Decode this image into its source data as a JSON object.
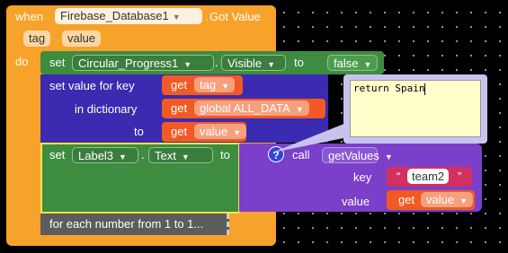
{
  "event": {
    "when": "when",
    "component": "Firebase_Database1",
    "dot": ".",
    "event_name": "Got Value",
    "params": [
      "tag",
      "value"
    ],
    "do": "do"
  },
  "set_visible": {
    "set": "set",
    "component": "Circular_Progress1",
    "dot": ".",
    "property": "Visible",
    "to": "to",
    "value": "false"
  },
  "dict_block": {
    "label_set_value": "set value for key",
    "label_in_dict": "in dictionary",
    "label_to": "to",
    "get1": {
      "get": "get",
      "var": "tag"
    },
    "get2": {
      "get": "get",
      "var": "global ALL_DATA"
    },
    "get3": {
      "get": "get",
      "var": "value"
    }
  },
  "set_text": {
    "set": "set",
    "component": "Label3",
    "dot": ".",
    "property": "Text",
    "to": "to"
  },
  "call_block": {
    "question": "?",
    "call": "call",
    "proc": "getValues",
    "key_label": "key",
    "value_label": "value",
    "key_string": "team2",
    "quote_open": "“",
    "quote_close": "”",
    "get_word": "get",
    "value_var": "value"
  },
  "comment": {
    "text": "return Spain"
  },
  "collapsed": {
    "text": "for each number from 1 to 1..."
  },
  "colors": {
    "event": "#f7a22a",
    "component_green": "#3d8c40",
    "dict_blue": "#3a2bb0",
    "variable_orange": "#f15a24",
    "procedure_purple": "#7b3fc9",
    "text_pink": "#d4305f",
    "collapsed_grey": "#5c5c5c",
    "selected_outline": "#f5e642"
  }
}
